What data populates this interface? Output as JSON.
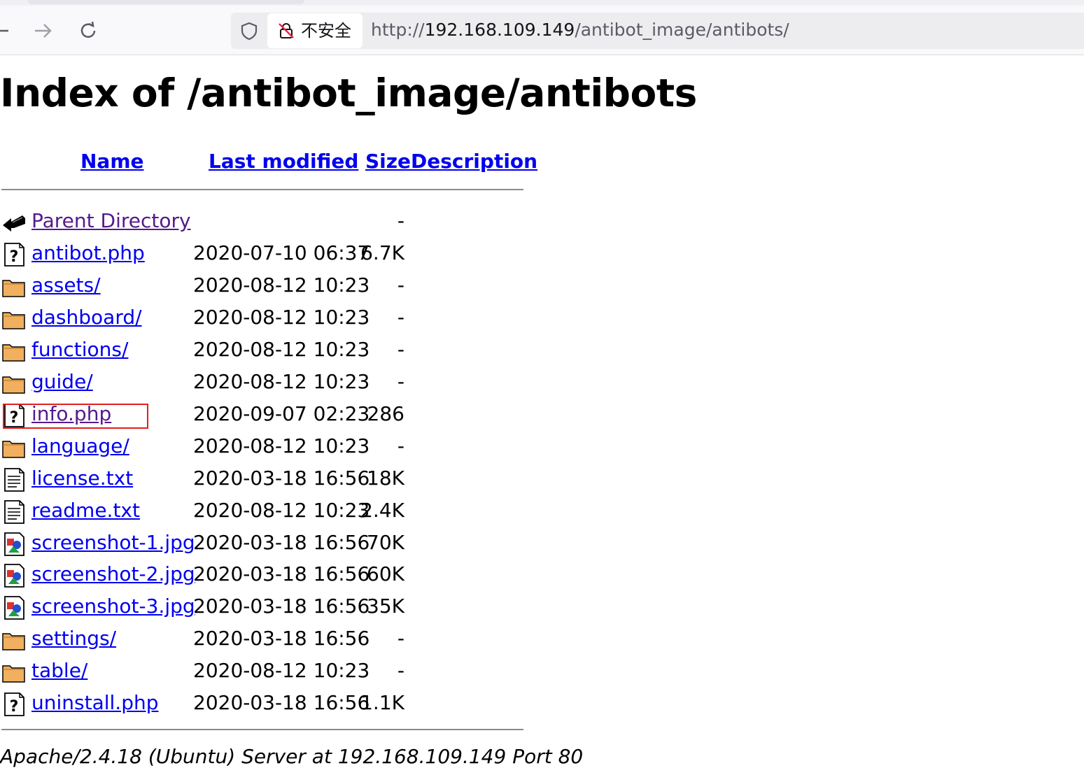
{
  "browser": {
    "security_label": "不安全",
    "url_scheme": "http://",
    "url_host": "192.168.109.149",
    "url_path": "/antibot_image/antibots/"
  },
  "page": {
    "title": "Index of /antibot_image/antibots",
    "headers": {
      "name": "Name",
      "last_modified": "Last modified",
      "size": "Size",
      "description": "Description"
    },
    "entries": [
      {
        "icon": "back-icon",
        "name": "Parent Directory",
        "date": "",
        "size": "-",
        "visited": true
      },
      {
        "icon": "unknown-file-icon",
        "name": "antibot.php",
        "date": "2020-07-10 06:37",
        "size": "6.7K",
        "visited": false
      },
      {
        "icon": "folder-icon",
        "name": "assets/",
        "date": "2020-08-12 10:23",
        "size": "-",
        "visited": false
      },
      {
        "icon": "folder-icon",
        "name": "dashboard/",
        "date": "2020-08-12 10:23",
        "size": "-",
        "visited": false
      },
      {
        "icon": "folder-icon",
        "name": "functions/",
        "date": "2020-08-12 10:23",
        "size": "-",
        "visited": false
      },
      {
        "icon": "folder-icon",
        "name": "guide/",
        "date": "2020-08-12 10:23",
        "size": "-",
        "visited": false
      },
      {
        "icon": "unknown-file-icon",
        "name": "info.php",
        "date": "2020-09-07 02:23",
        "size": "286",
        "visited": true
      },
      {
        "icon": "folder-icon",
        "name": "language/",
        "date": "2020-08-12 10:23",
        "size": "-",
        "visited": false
      },
      {
        "icon": "text-file-icon",
        "name": "license.txt",
        "date": "2020-03-18 16:56",
        "size": "18K",
        "visited": false
      },
      {
        "icon": "text-file-icon",
        "name": "readme.txt",
        "date": "2020-08-12 10:23",
        "size": "2.4K",
        "visited": false
      },
      {
        "icon": "image-file-icon",
        "name": "screenshot-1.jpg",
        "date": "2020-03-18 16:56",
        "size": "70K",
        "visited": false
      },
      {
        "icon": "image-file-icon",
        "name": "screenshot-2.jpg",
        "date": "2020-03-18 16:56",
        "size": "60K",
        "visited": false
      },
      {
        "icon": "image-file-icon",
        "name": "screenshot-3.jpg",
        "date": "2020-03-18 16:56",
        "size": "35K",
        "visited": false
      },
      {
        "icon": "folder-icon",
        "name": "settings/",
        "date": "2020-03-18 16:56",
        "size": "-",
        "visited": false
      },
      {
        "icon": "folder-icon",
        "name": "table/",
        "date": "2020-08-12 10:23",
        "size": "-",
        "visited": false
      },
      {
        "icon": "unknown-file-icon",
        "name": "uninstall.php",
        "date": "2020-03-18 16:56",
        "size": "1.1K",
        "visited": false
      }
    ],
    "footer": "Apache/2.4.18 (Ubuntu) Server at 192.168.109.149 Port 80"
  },
  "colors": {
    "link": "#0000ee",
    "visited_link": "#551a8b",
    "highlight": "#e02020"
  }
}
